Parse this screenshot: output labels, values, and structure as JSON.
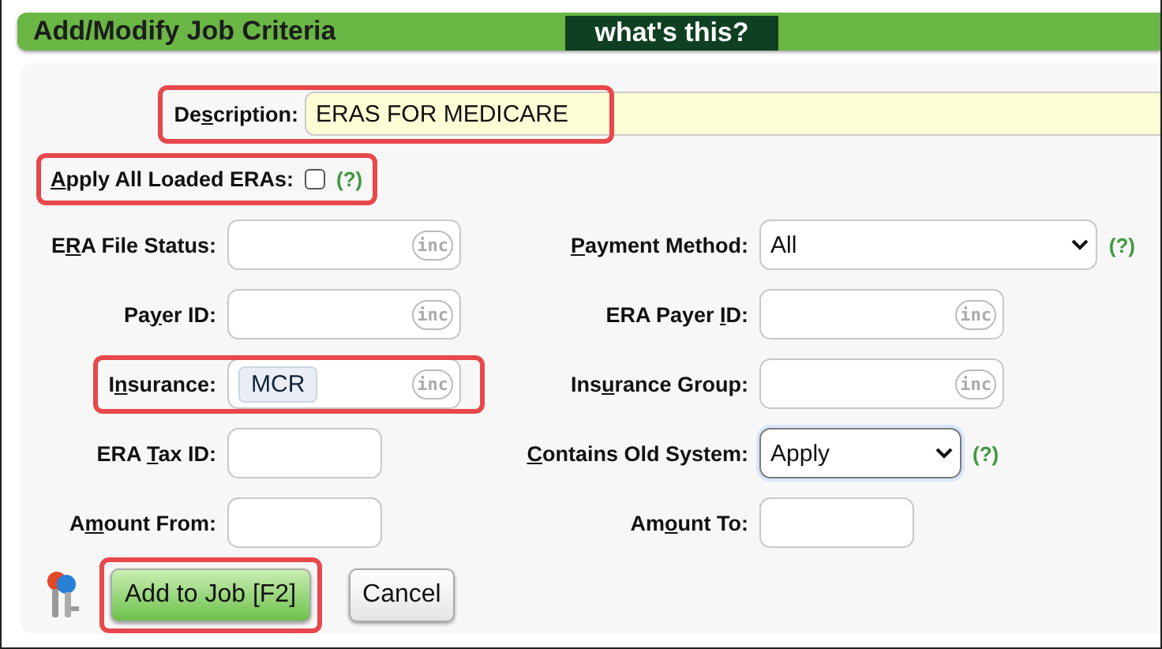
{
  "header": {
    "title": "Add/Modify Job Criteria",
    "help_link": "what's this?"
  },
  "description": {
    "label": {
      "before": "De",
      "key": "s",
      "after": "cription:"
    },
    "value": "ERAS FOR MEDICARE",
    "highlighted": true
  },
  "apply_all": {
    "label": {
      "key": "A",
      "after": "pply All Loaded ERAs:"
    },
    "checked": false,
    "help": "(?)",
    "highlighted": true
  },
  "rows": [
    {
      "left": {
        "label": {
          "before": "E",
          "key": "R",
          "after": "A File Status:"
        },
        "kind": "inc",
        "badge": "inc",
        "highlighted": false
      },
      "right": {
        "label": {
          "key": "P",
          "after": "ayment Method:"
        },
        "kind": "select",
        "value": "All",
        "help": "(?)",
        "focused": false
      }
    },
    {
      "left": {
        "label": {
          "before": "Pa",
          "key": "y",
          "after": "er ID:"
        },
        "kind": "inc",
        "badge": "inc",
        "highlighted": false
      },
      "right": {
        "label": {
          "before": "ERA Payer ",
          "key": "I",
          "after": "D:"
        },
        "kind": "inc",
        "badge": "inc"
      }
    },
    {
      "left": {
        "label": {
          "before": "I",
          "key": "n",
          "after": "surance:"
        },
        "kind": "inc",
        "badge": "inc",
        "tokens": [
          "MCR"
        ],
        "highlighted": true
      },
      "right": {
        "label": {
          "before": "Ins",
          "key": "u",
          "after": "rance Group:"
        },
        "kind": "inc",
        "badge": "inc"
      }
    },
    {
      "left": {
        "label": {
          "before": "ERA ",
          "key": "T",
          "after": "ax ID:"
        },
        "kind": "text",
        "highlighted": false
      },
      "right": {
        "label": {
          "key": "C",
          "after": "ontains Old System:"
        },
        "kind": "select-short",
        "value": "Apply",
        "help": "(?)",
        "focused": true
      }
    },
    {
      "left": {
        "label": {
          "before": "A",
          "key": "m",
          "after": "ount From:"
        },
        "kind": "text",
        "highlighted": false
      },
      "right": {
        "label": {
          "before": "Am",
          "key": "o",
          "after": "unt To:"
        },
        "kind": "text"
      }
    }
  ],
  "buttons": [
    {
      "kind": "primary",
      "label": "Add to Job [F2]",
      "highlighted": true
    },
    {
      "kind": "secondary",
      "label": "Cancel",
      "highlighted": false
    }
  ]
}
